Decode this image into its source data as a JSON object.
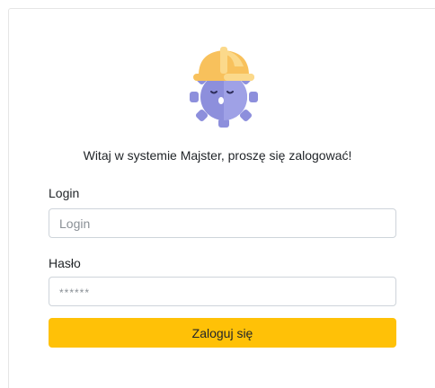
{
  "mascot": {
    "icon": "hard-hat-gear-mascot-icon",
    "colors": {
      "hat": "#f8c15c",
      "hat_light": "#fbd98b",
      "gear": "#8d8fdc",
      "gear_dark": "#7c7ed2"
    }
  },
  "welcome_text": "Witaj w systemie Majster, proszę się zalogować!",
  "login": {
    "label": "Login",
    "placeholder": "Login"
  },
  "password": {
    "label": "Hasło",
    "placeholder": "******"
  },
  "submit_label": "Zaloguj się",
  "colors": {
    "accent": "#ffc107",
    "input_border": "#ced4da"
  }
}
